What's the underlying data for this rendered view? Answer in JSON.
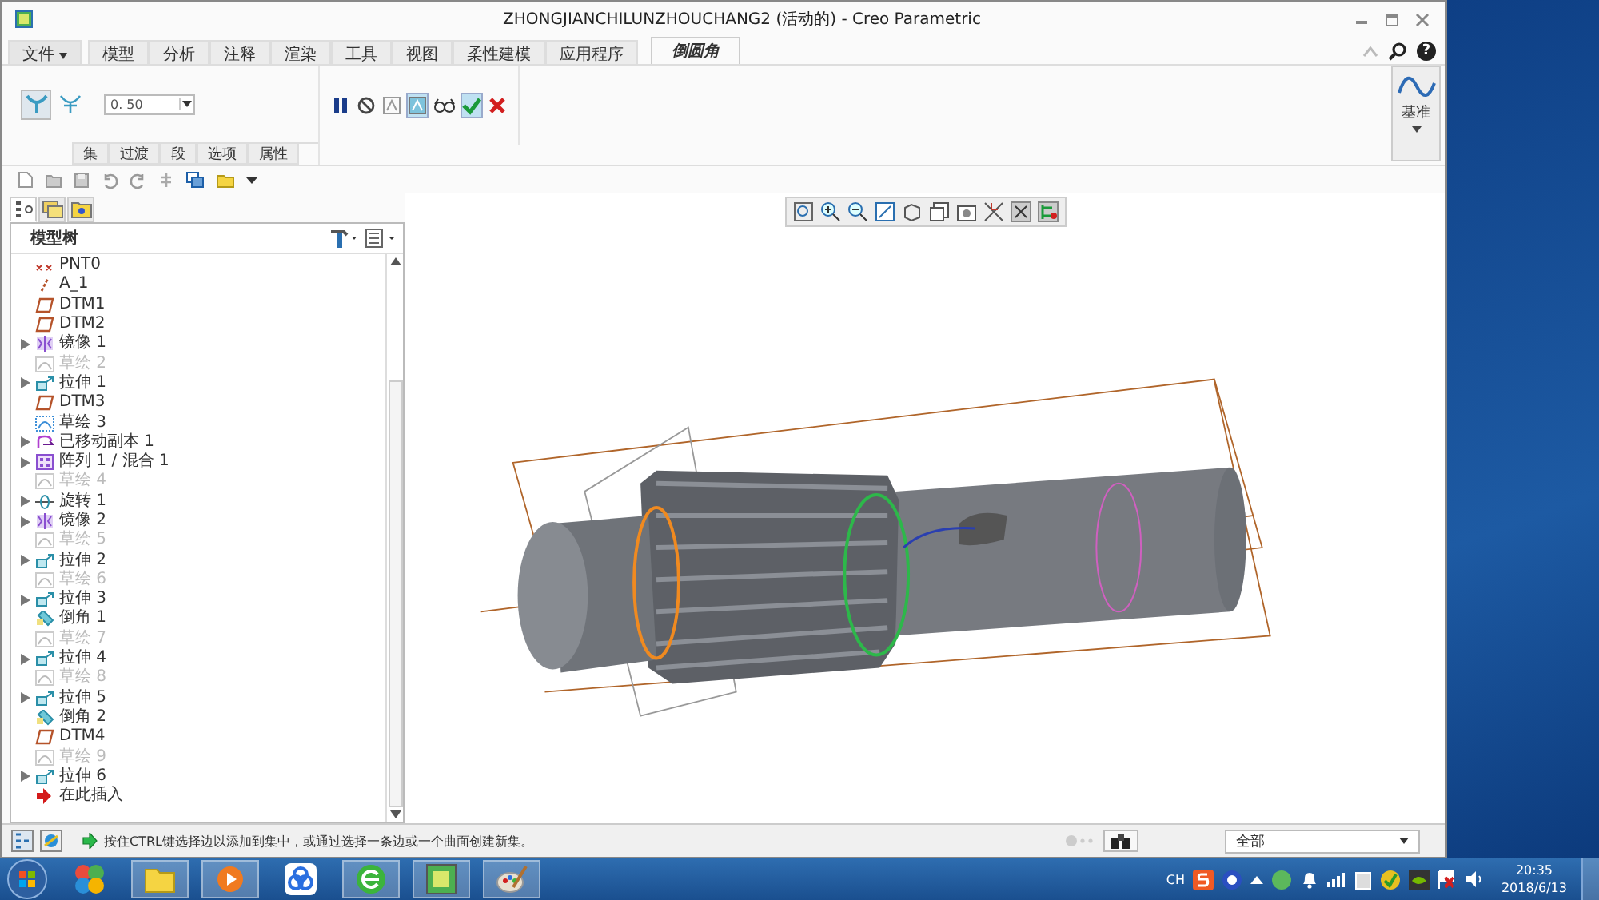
{
  "window": {
    "title": "ZHONGJIANCHILUNZHOUCHANG2 (活动的) - Creo Parametric"
  },
  "ribbon_tabs": [
    {
      "label": "文件",
      "kind": "menu",
      "selected": false
    },
    {
      "label": "模型",
      "kind": "tab",
      "selected": false
    },
    {
      "label": "分析",
      "kind": "tab",
      "selected": false
    },
    {
      "label": "注释",
      "kind": "tab",
      "selected": false
    },
    {
      "label": "渲染",
      "kind": "tab",
      "selected": false
    },
    {
      "label": "工具",
      "kind": "tab",
      "selected": false
    },
    {
      "label": "视图",
      "kind": "tab",
      "selected": false
    },
    {
      "label": "柔性建模",
      "kind": "tab",
      "selected": false
    },
    {
      "label": "应用程序",
      "kind": "tab",
      "selected": false
    },
    {
      "label": "倒圆角",
      "kind": "tab",
      "selected": true
    }
  ],
  "ribbon": {
    "modes": [
      {
        "kind": "set",
        "selected": true
      },
      {
        "kind": "transition",
        "selected": false
      }
    ],
    "radius_field": {
      "value": "0. 50"
    },
    "sub_tabs": [
      "集",
      "过渡",
      "段",
      "选项",
      "属性"
    ],
    "actions": [
      {
        "kind": "pause",
        "selected": false
      },
      {
        "kind": "no-preview",
        "selected": false
      },
      {
        "kind": "preview",
        "selected": false
      },
      {
        "kind": "verify",
        "selected": true
      },
      {
        "kind": "glasses",
        "selected": false
      },
      {
        "kind": "ok",
        "selected": true
      },
      {
        "kind": "cancel",
        "selected": false
      }
    ],
    "datum_button": {
      "label": "基准"
    }
  },
  "panel_tabs": [
    {
      "kind": "tree",
      "selected": true
    },
    {
      "kind": "folders",
      "selected": false
    },
    {
      "kind": "favorites",
      "selected": false
    }
  ],
  "model_tree": {
    "title": "模型树",
    "items": [
      {
        "label": "PNT0",
        "kind": "point",
        "expandable": false,
        "disabled": false
      },
      {
        "label": "A_1",
        "kind": "axis",
        "expandable": false,
        "disabled": false
      },
      {
        "label": "DTM1",
        "kind": "plane",
        "expandable": false,
        "disabled": false
      },
      {
        "label": "DTM2",
        "kind": "plane",
        "expandable": false,
        "disabled": false
      },
      {
        "label": "镜像 1",
        "kind": "mirror",
        "expandable": true,
        "disabled": false
      },
      {
        "label": "草绘 2",
        "kind": "sketch",
        "expandable": false,
        "disabled": true
      },
      {
        "label": "拉伸 1",
        "kind": "extrude",
        "expandable": true,
        "disabled": false
      },
      {
        "label": "DTM3",
        "kind": "plane",
        "expandable": false,
        "disabled": false
      },
      {
        "label": "草绘 3",
        "kind": "sketch",
        "expandable": false,
        "disabled": false
      },
      {
        "label": "已移动副本 1",
        "kind": "copy",
        "expandable": true,
        "disabled": false
      },
      {
        "label": "阵列 1 / 混合 1",
        "kind": "pattern",
        "expandable": true,
        "disabled": false
      },
      {
        "label": "草绘 4",
        "kind": "sketch",
        "expandable": false,
        "disabled": true
      },
      {
        "label": "旋转 1",
        "kind": "revolve",
        "expandable": true,
        "disabled": false
      },
      {
        "label": "镜像 2",
        "kind": "mirror",
        "expandable": true,
        "disabled": false
      },
      {
        "label": "草绘 5",
        "kind": "sketch",
        "expandable": false,
        "disabled": true
      },
      {
        "label": "拉伸 2",
        "kind": "extrude",
        "expandable": true,
        "disabled": false
      },
      {
        "label": "草绘 6",
        "kind": "sketch",
        "expandable": false,
        "disabled": true
      },
      {
        "label": "拉伸 3",
        "kind": "extrude",
        "expandable": true,
        "disabled": false
      },
      {
        "label": "倒角 1",
        "kind": "chamfer",
        "expandable": false,
        "disabled": false
      },
      {
        "label": "草绘 7",
        "kind": "sketch",
        "expandable": false,
        "disabled": true
      },
      {
        "label": "拉伸 4",
        "kind": "extrude",
        "expandable": true,
        "disabled": false
      },
      {
        "label": "草绘 8",
        "kind": "sketch",
        "expandable": false,
        "disabled": true
      },
      {
        "label": "拉伸 5",
        "kind": "extrude",
        "expandable": true,
        "disabled": false
      },
      {
        "label": "倒角 2",
        "kind": "chamfer",
        "expandable": false,
        "disabled": false
      },
      {
        "label": "DTM4",
        "kind": "plane",
        "expandable": false,
        "disabled": false
      },
      {
        "label": "草绘 9",
        "kind": "sketch",
        "expandable": false,
        "disabled": true
      },
      {
        "label": "拉伸 6",
        "kind": "extrude",
        "expandable": true,
        "disabled": false
      },
      {
        "label": "在此插入",
        "kind": "insert",
        "expandable": false,
        "disabled": false
      }
    ]
  },
  "help_button": {
    "label": "?"
  },
  "status_bar": {
    "message": "按住CTRL键选择边以添加到集中，或通过选择一条边或一个曲面创建新集。",
    "filter": "全部"
  },
  "taskbar": {
    "language": "CH",
    "time": "20:35",
    "date": "2018/6/13"
  }
}
